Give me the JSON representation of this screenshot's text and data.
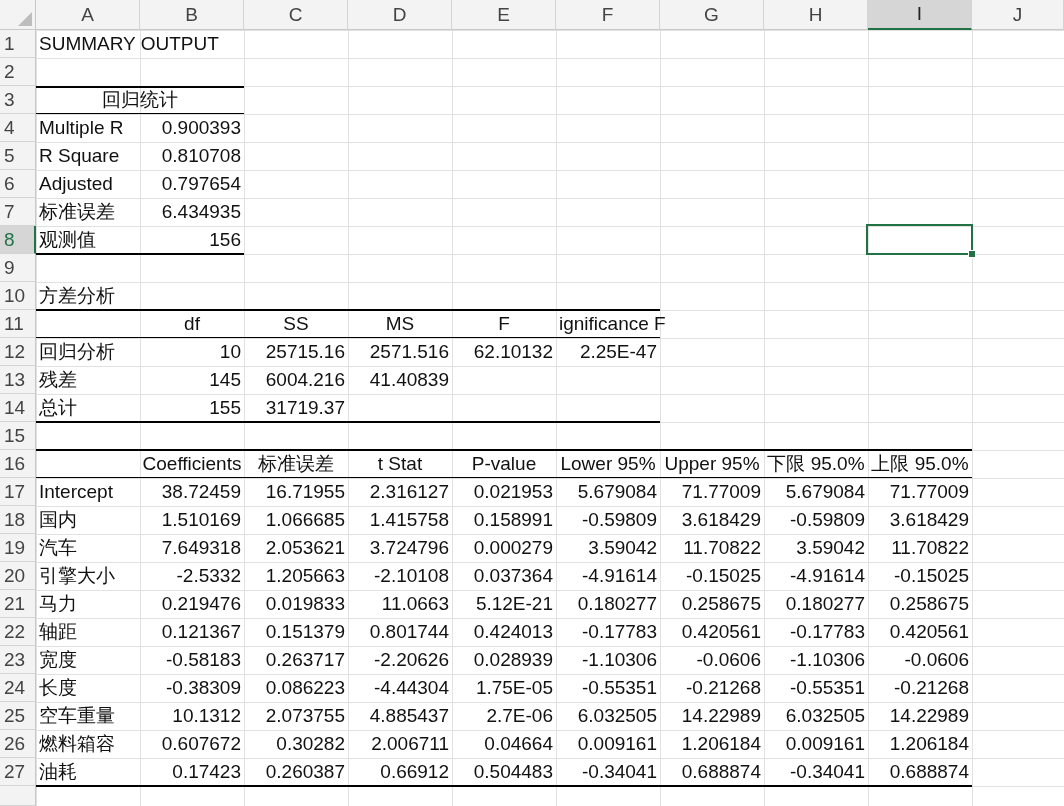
{
  "columns": [
    {
      "label": "A",
      "selected": false
    },
    {
      "label": "B",
      "selected": false
    },
    {
      "label": "C",
      "selected": false
    },
    {
      "label": "D",
      "selected": false
    },
    {
      "label": "E",
      "selected": false
    },
    {
      "label": "F",
      "selected": false
    },
    {
      "label": "G",
      "selected": false
    },
    {
      "label": "H",
      "selected": false
    },
    {
      "label": "I",
      "selected": true
    },
    {
      "label": "J",
      "selected": false
    }
  ],
  "rows": [
    {
      "number": "1",
      "selected": false,
      "cells": [
        {
          "text": "SUMMARY OUTPUT",
          "kind": "label"
        }
      ]
    },
    {
      "number": "2",
      "selected": false
    },
    {
      "number": "3",
      "selected": false,
      "cells": [
        {
          "text": "回归统计",
          "kind": "heading",
          "wide": true,
          "heavy_rule_above": true,
          "rule_below": true
        }
      ]
    },
    {
      "number": "4",
      "selected": false,
      "cells": [
        {
          "text": "Multiple R",
          "kind": "label"
        },
        {
          "text": "0.900393",
          "kind": "number"
        }
      ]
    },
    {
      "number": "5",
      "selected": false,
      "cells": [
        {
          "text": "R Square",
          "kind": "label"
        },
        {
          "text": "0.810708",
          "kind": "number"
        }
      ]
    },
    {
      "number": "6",
      "selected": false,
      "cells": [
        {
          "text": "Adjusted",
          "kind": "label"
        },
        {
          "text": "0.797654",
          "kind": "number"
        }
      ]
    },
    {
      "number": "7",
      "selected": false,
      "cells": [
        {
          "text": "标准误差",
          "kind": "label"
        },
        {
          "text": "6.434935",
          "kind": "number"
        }
      ]
    },
    {
      "number": "8",
      "selected": true,
      "cells": [
        {
          "text": "观测值",
          "kind": "label",
          "heavy_rule_below": true
        },
        {
          "text": "156",
          "kind": "number",
          "heavy_rule_below": true
        }
      ]
    },
    {
      "number": "9",
      "selected": false
    },
    {
      "number": "10",
      "selected": false,
      "cells": [
        {
          "text": "方差分析",
          "kind": "label",
          "heavy_rule_below": true
        },
        {
          "heavy_rule_below": true
        },
        {
          "heavy_rule_below": true
        },
        {
          "heavy_rule_below": true
        },
        {
          "heavy_rule_below": true
        },
        {
          "heavy_rule_below": true
        }
      ]
    },
    {
      "number": "11",
      "selected": false,
      "cells": [
        {
          "rule_below": true
        },
        {
          "text": "df",
          "kind": "heading",
          "rule_below": true
        },
        {
          "text": "SS",
          "kind": "heading",
          "rule_below": true
        },
        {
          "text": "MS",
          "kind": "heading",
          "rule_below": true
        },
        {
          "text": "F",
          "kind": "heading",
          "rule_below": true
        },
        {
          "text": "ignificance F",
          "kind": "label",
          "rule_below": true
        }
      ]
    },
    {
      "number": "12",
      "selected": false,
      "cells": [
        {
          "text": "回归分析",
          "kind": "label"
        },
        {
          "text": "10",
          "kind": "number"
        },
        {
          "text": "25715.16",
          "kind": "number"
        },
        {
          "text": "2571.516",
          "kind": "number"
        },
        {
          "text": "62.10132",
          "kind": "number"
        },
        {
          "text": "2.25E-47",
          "kind": "number"
        }
      ]
    },
    {
      "number": "13",
      "selected": false,
      "cells": [
        {
          "text": "残差",
          "kind": "label"
        },
        {
          "text": "145",
          "kind": "number"
        },
        {
          "text": "6004.216",
          "kind": "number"
        },
        {
          "text": "41.40839",
          "kind": "number"
        }
      ]
    },
    {
      "number": "14",
      "selected": false,
      "cells": [
        {
          "text": "总计",
          "kind": "label",
          "heavy_rule_below": true
        },
        {
          "text": "155",
          "kind": "number",
          "heavy_rule_below": true
        },
        {
          "text": "31719.37",
          "kind": "number",
          "heavy_rule_below": true
        },
        {
          "heavy_rule_below": true
        },
        {
          "heavy_rule_below": true
        },
        {
          "heavy_rule_below": true
        }
      ]
    },
    {
      "number": "15",
      "selected": false,
      "cells": [
        {
          "heavy_rule_below": true
        },
        {
          "heavy_rule_below": true
        },
        {
          "heavy_rule_below": true
        },
        {
          "heavy_rule_below": true
        },
        {
          "heavy_rule_below": true
        },
        {
          "heavy_rule_below": true
        },
        {
          "heavy_rule_below": true
        },
        {
          "heavy_rule_below": true
        },
        {
          "heavy_rule_below": true
        }
      ]
    },
    {
      "number": "16",
      "selected": false,
      "cells": [
        {
          "rule_below": true
        },
        {
          "text": "Coefficients",
          "kind": "heading",
          "rule_below": true
        },
        {
          "text": "标准误差",
          "kind": "heading",
          "rule_below": true
        },
        {
          "text": "t Stat",
          "kind": "heading",
          "rule_below": true
        },
        {
          "text": "P-value",
          "kind": "heading",
          "rule_below": true
        },
        {
          "text": "Lower 95%",
          "kind": "heading",
          "rule_below": true
        },
        {
          "text": "Upper 95%",
          "kind": "heading",
          "rule_below": true
        },
        {
          "text": "下限 95.0%",
          "kind": "heading",
          "rule_below": true
        },
        {
          "text": "上限 95.0%",
          "kind": "heading",
          "rule_below": true
        }
      ]
    },
    {
      "number": "17",
      "selected": false,
      "cells": [
        {
          "text": "Intercept",
          "kind": "label"
        },
        {
          "text": "38.72459",
          "kind": "number"
        },
        {
          "text": "16.71955",
          "kind": "number"
        },
        {
          "text": "2.316127",
          "kind": "number"
        },
        {
          "text": "0.021953",
          "kind": "number"
        },
        {
          "text": "5.679084",
          "kind": "number"
        },
        {
          "text": "71.77009",
          "kind": "number"
        },
        {
          "text": "5.679084",
          "kind": "number"
        },
        {
          "text": "71.77009",
          "kind": "number"
        }
      ]
    },
    {
      "number": "18",
      "selected": false,
      "cells": [
        {
          "text": "国内",
          "kind": "label"
        },
        {
          "text": "1.510169",
          "kind": "number"
        },
        {
          "text": "1.066685",
          "kind": "number"
        },
        {
          "text": "1.415758",
          "kind": "number"
        },
        {
          "text": "0.158991",
          "kind": "number"
        },
        {
          "text": "-0.59809",
          "kind": "number"
        },
        {
          "text": "3.618429",
          "kind": "number"
        },
        {
          "text": "-0.59809",
          "kind": "number"
        },
        {
          "text": "3.618429",
          "kind": "number"
        }
      ]
    },
    {
      "number": "19",
      "selected": false,
      "cells": [
        {
          "text": "汽车",
          "kind": "label"
        },
        {
          "text": "7.649318",
          "kind": "number"
        },
        {
          "text": "2.053621",
          "kind": "number"
        },
        {
          "text": "3.724796",
          "kind": "number"
        },
        {
          "text": "0.000279",
          "kind": "number"
        },
        {
          "text": "3.59042",
          "kind": "number"
        },
        {
          "text": "11.70822",
          "kind": "number"
        },
        {
          "text": "3.59042",
          "kind": "number"
        },
        {
          "text": "11.70822",
          "kind": "number"
        }
      ]
    },
    {
      "number": "20",
      "selected": false,
      "cells": [
        {
          "text": "引擎大小",
          "kind": "label"
        },
        {
          "text": "-2.5332",
          "kind": "number"
        },
        {
          "text": "1.205663",
          "kind": "number"
        },
        {
          "text": "-2.10108",
          "kind": "number"
        },
        {
          "text": "0.037364",
          "kind": "number"
        },
        {
          "text": "-4.91614",
          "kind": "number"
        },
        {
          "text": "-0.15025",
          "kind": "number"
        },
        {
          "text": "-4.91614",
          "kind": "number"
        },
        {
          "text": "-0.15025",
          "kind": "number"
        }
      ]
    },
    {
      "number": "21",
      "selected": false,
      "cells": [
        {
          "text": "马力",
          "kind": "label"
        },
        {
          "text": "0.219476",
          "kind": "number"
        },
        {
          "text": "0.019833",
          "kind": "number"
        },
        {
          "text": "11.0663",
          "kind": "number"
        },
        {
          "text": "5.12E-21",
          "kind": "number"
        },
        {
          "text": "0.180277",
          "kind": "number"
        },
        {
          "text": "0.258675",
          "kind": "number"
        },
        {
          "text": "0.180277",
          "kind": "number"
        },
        {
          "text": "0.258675",
          "kind": "number"
        }
      ]
    },
    {
      "number": "22",
      "selected": false,
      "cells": [
        {
          "text": "轴距",
          "kind": "label"
        },
        {
          "text": "0.121367",
          "kind": "number"
        },
        {
          "text": "0.151379",
          "kind": "number"
        },
        {
          "text": "0.801744",
          "kind": "number"
        },
        {
          "text": "0.424013",
          "kind": "number"
        },
        {
          "text": "-0.17783",
          "kind": "number"
        },
        {
          "text": "0.420561",
          "kind": "number"
        },
        {
          "text": "-0.17783",
          "kind": "number"
        },
        {
          "text": "0.420561",
          "kind": "number"
        }
      ]
    },
    {
      "number": "23",
      "selected": false,
      "cells": [
        {
          "text": "宽度",
          "kind": "label"
        },
        {
          "text": "-0.58183",
          "kind": "number"
        },
        {
          "text": "0.263717",
          "kind": "number"
        },
        {
          "text": "-2.20626",
          "kind": "number"
        },
        {
          "text": "0.028939",
          "kind": "number"
        },
        {
          "text": "-1.10306",
          "kind": "number"
        },
        {
          "text": "-0.0606",
          "kind": "number"
        },
        {
          "text": "-1.10306",
          "kind": "number"
        },
        {
          "text": "-0.0606",
          "kind": "number"
        }
      ]
    },
    {
      "number": "24",
      "selected": false,
      "cells": [
        {
          "text": "长度",
          "kind": "label"
        },
        {
          "text": "-0.38309",
          "kind": "number"
        },
        {
          "text": "0.086223",
          "kind": "number"
        },
        {
          "text": "-4.44304",
          "kind": "number"
        },
        {
          "text": "1.75E-05",
          "kind": "number"
        },
        {
          "text": "-0.55351",
          "kind": "number"
        },
        {
          "text": "-0.21268",
          "kind": "number"
        },
        {
          "text": "-0.55351",
          "kind": "number"
        },
        {
          "text": "-0.21268",
          "kind": "number"
        }
      ]
    },
    {
      "number": "25",
      "selected": false,
      "cells": [
        {
          "text": "空车重量",
          "kind": "label"
        },
        {
          "text": "10.1312",
          "kind": "number"
        },
        {
          "text": "2.073755",
          "kind": "number"
        },
        {
          "text": "4.885437",
          "kind": "number"
        },
        {
          "text": "2.7E-06",
          "kind": "number"
        },
        {
          "text": "6.032505",
          "kind": "number"
        },
        {
          "text": "14.22989",
          "kind": "number"
        },
        {
          "text": "6.032505",
          "kind": "number"
        },
        {
          "text": "14.22989",
          "kind": "number"
        }
      ]
    },
    {
      "number": "26",
      "selected": false,
      "cells": [
        {
          "text": "燃料箱容",
          "kind": "label"
        },
        {
          "text": "0.607672",
          "kind": "number"
        },
        {
          "text": "0.30282",
          "kind": "number"
        },
        {
          "text": "2.006711",
          "kind": "number"
        },
        {
          "text": "0.04664",
          "kind": "number"
        },
        {
          "text": "0.009161",
          "kind": "number"
        },
        {
          "text": "1.206184",
          "kind": "number"
        },
        {
          "text": "0.009161",
          "kind": "number"
        },
        {
          "text": "1.206184",
          "kind": "number"
        }
      ]
    },
    {
      "number": "27",
      "selected": false,
      "cells": [
        {
          "text": "油耗",
          "kind": "label",
          "heavy_rule_below": true
        },
        {
          "text": "0.17423",
          "kind": "number",
          "heavy_rule_below": true
        },
        {
          "text": "0.260387",
          "kind": "number",
          "heavy_rule_below": true
        },
        {
          "text": "0.66912",
          "kind": "number",
          "heavy_rule_below": true
        },
        {
          "text": "0.504483",
          "kind": "number",
          "heavy_rule_below": true
        },
        {
          "text": "-0.34041",
          "kind": "number",
          "heavy_rule_below": true
        },
        {
          "text": "0.688874",
          "kind": "number",
          "heavy_rule_below": true
        },
        {
          "text": "-0.34041",
          "kind": "number",
          "heavy_rule_below": true
        },
        {
          "text": "0.688874",
          "kind": "number",
          "heavy_rule_below": true
        }
      ]
    },
    {
      "selected": false
    }
  ]
}
